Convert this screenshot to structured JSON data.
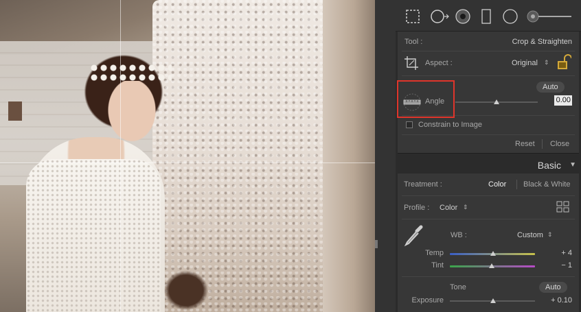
{
  "crop_panel": {
    "tool_label": "Tool :",
    "tool_value": "Crop & Straighten",
    "aspect_label": "Aspect :",
    "aspect_value": "Original",
    "auto_label": "Auto",
    "angle_label": "Angle",
    "angle_value": "0.00",
    "angle_fraction": 0.5,
    "constrain_label": "Constrain to Image",
    "reset_label": "Reset",
    "close_label": "Close"
  },
  "basic_panel": {
    "title": "Basic",
    "treatment_label": "Treatment :",
    "treatment_color": "Color",
    "treatment_bw": "Black & White",
    "profile_label": "Profile :",
    "profile_value": "Color",
    "wb_label": "WB :",
    "wb_value": "Custom",
    "temp_label": "Temp",
    "temp_value": "+ 4",
    "temp_fraction": 0.51,
    "tint_label": "Tint",
    "tint_value": "− 1",
    "tint_fraction": 0.49,
    "tone_label": "Tone",
    "tone_auto": "Auto",
    "exposure_label": "Exposure",
    "exposure_value": "+ 0.10",
    "exposure_fraction": 0.51
  },
  "icons": [
    "crop-overlay-icon",
    "spot-removal-icon",
    "red-eye-icon",
    "graduated-filter-icon",
    "radial-filter-icon",
    "adjustment-brush-icon",
    "lock-icon",
    "straighten-ruler-icon",
    "wb-eyedropper-icon",
    "profile-browser-icon"
  ],
  "colors": {
    "highlight": "#e0352b",
    "panel": "#373737"
  }
}
